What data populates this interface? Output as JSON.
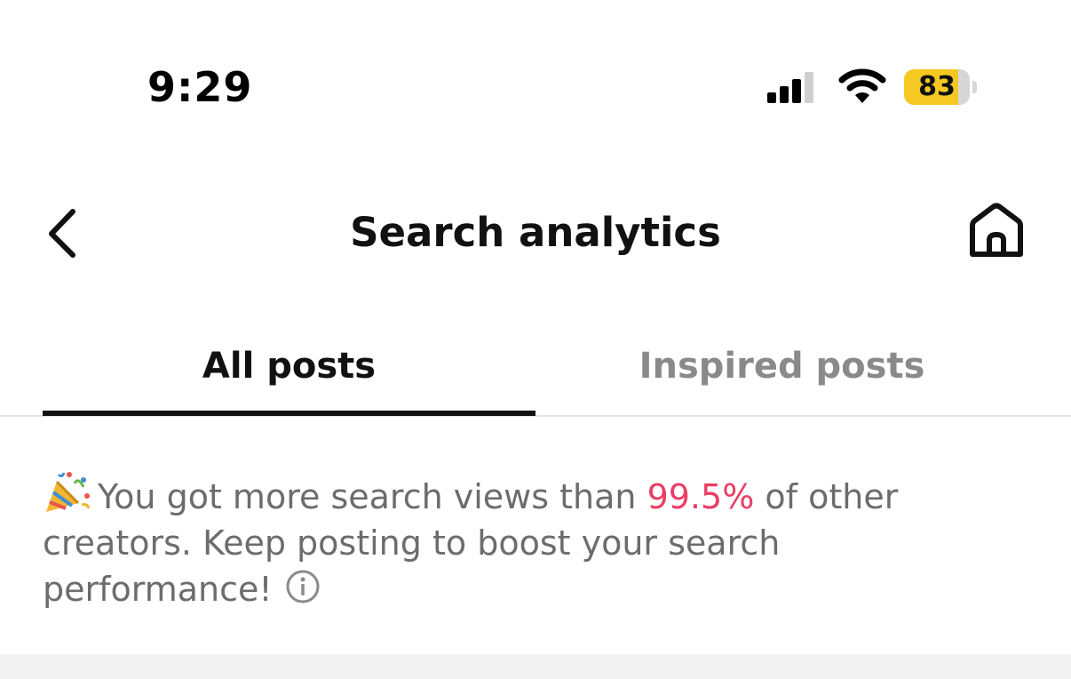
{
  "status_bar": {
    "time": "9:29",
    "battery_percent": "83",
    "battery_level": 0.83,
    "signal_bars_active": 3,
    "signal_bars_total": 4,
    "battery_color": "#f5c823"
  },
  "nav": {
    "title": "Search analytics",
    "back_icon": "chevron-left-icon",
    "home_icon": "home-icon"
  },
  "tabs": [
    {
      "label": "All posts",
      "active": true
    },
    {
      "label": "Inspired posts",
      "active": false
    }
  ],
  "message": {
    "emoji_icon": "party-popper-icon",
    "text_before": "You got more search views than",
    "highlight": "99.5%",
    "text_after": "of other creators. Keep posting to boost your search performance!",
    "highlight_color": "#ea3e64",
    "info_icon": "info-icon"
  }
}
